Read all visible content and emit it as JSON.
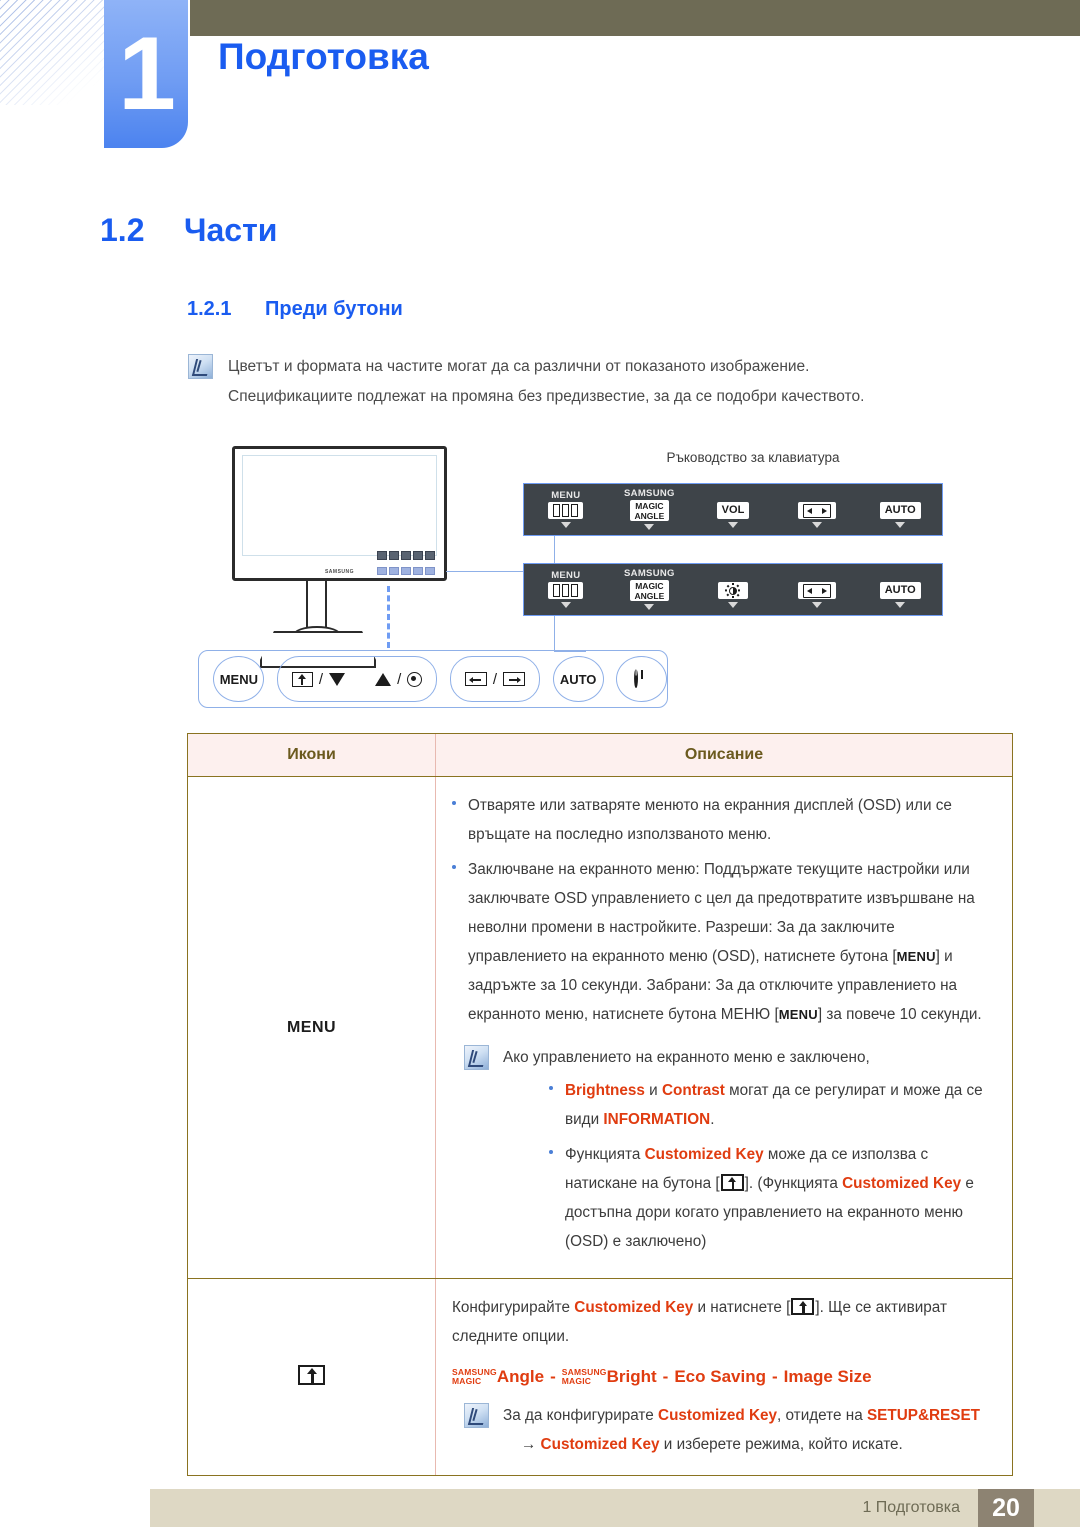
{
  "chapter": {
    "number": "1",
    "title": "Подготовка"
  },
  "headings": {
    "h1_num": "1.2",
    "h1_text": "Части",
    "h2_num": "1.2.1",
    "h2_text": "Преди бутони"
  },
  "top_note": {
    "icon": "note-icon",
    "line1": "Цветът и формата на частите могат да са различни от показаното изображение.",
    "line2": "Спецификациите подлежат на промяна без предизвестие, за да се подобри качеството."
  },
  "figure": {
    "monitor_logo": "SAMSUNG",
    "keyboard_guide_title": "Ръководство за клавиатура",
    "panels": [
      {
        "keys": [
          {
            "cap": "MENU",
            "glyph": "menu-bars-icon",
            "label": ""
          },
          {
            "cap": "SAMSUNG",
            "glyph": "magic-angle-box",
            "label": "MAGIC / ANGLE"
          },
          {
            "cap": "",
            "glyph": "text-box",
            "label": "VOL"
          },
          {
            "cap": "",
            "glyph": "source-icon",
            "label": ""
          },
          {
            "cap": "",
            "glyph": "text-box",
            "label": "AUTO"
          }
        ]
      },
      {
        "keys": [
          {
            "cap": "MENU",
            "glyph": "menu-bars-icon",
            "label": ""
          },
          {
            "cap": "SAMSUNG",
            "glyph": "magic-angle-box",
            "label": "MAGIC / ANGLE"
          },
          {
            "cap": "",
            "glyph": "brightness-icon",
            "label": ""
          },
          {
            "cap": "",
            "glyph": "source-icon",
            "label": ""
          },
          {
            "cap": "",
            "glyph": "text-box",
            "label": "AUTO"
          }
        ]
      }
    ],
    "magic_top": "MAGIC",
    "magic_bottom": "ANGLE",
    "vol_label": "VOL",
    "auto_label": "AUTO",
    "samsung_label": "SAMSUNG",
    "menu_label": "MENU",
    "control_bar": {
      "menu": "MENU",
      "slash": "/",
      "auto": "AUTO"
    }
  },
  "table": {
    "headers": {
      "icons": "Икони",
      "description": "Описание"
    },
    "rows": [
      {
        "icon_label": "MENU",
        "icon_name": "menu-text-icon",
        "bullets": [
          "Отваряте или затваряте менюто на екранния дисплей (OSD) или се връщате на последно използваното меню.",
          "Заключване на екранното меню: Поддържате текущите настройки или заключвате OSD управлението с цел да предотвратите извършване на неволни промени в настройките. Разреши: За да заключите управлението на екранното меню (OSD), натиснете бутона"
        ],
        "lock_part2": "и задръжте за 10 секунди. Забрани: За да отключите управлението на екранното меню, натиснете бутона МЕНЮ",
        "lock_part3": "за повече 10 секунди.",
        "menu_kbd": "MENU",
        "note": {
          "intro": "Ако управлението на екранното меню е заключено,",
          "b1_a": "Brightness",
          "b1_and": "и",
          "b1_b": "Contrast",
          "b1_c": "могат да се регулират и може да се види",
          "b1_d": "INFORMATION",
          "b1_end": ".",
          "b2_a": "Функцията",
          "b2_b": "Customized Key",
          "b2_c": "може да се използва с натискане на бутона [",
          "b2_d": "]. (Функцията",
          "b2_e": "Customized Key",
          "b2_f": "е достъпна дори когато управлението на екранното меню (OSD) е заключено)"
        }
      },
      {
        "icon_label": "",
        "icon_name": "customized-key-icon",
        "line1_a": "Конфигурирайте",
        "line1_b": "Customized Key",
        "line1_c": "и натиснете [",
        "line1_d": "]. Ще се активират следните опции.",
        "options": {
          "magic1_top": "SAMSUNG",
          "magic1_bottom": "MAGIC",
          "opt1": "Angle",
          "magic2_top": "SAMSUNG",
          "magic2_bottom": "MAGIC",
          "opt2": "Bright",
          "opt3": "Eco Saving",
          "opt4": "Image Size",
          "separator": "-"
        },
        "note": {
          "a": "За да конфигурирате",
          "b": "Customized Key",
          "c": ", отидете на",
          "d": "SETUP&RESET",
          "arrow": "→",
          "e": "Customized Key",
          "f": "и изберете режима, който искате."
        }
      }
    ]
  },
  "footer": {
    "text": "1 Подготовка",
    "page": "20"
  },
  "colors": {
    "accent_blue": "#1a5cf0",
    "keyword_red": "#e03c10",
    "table_border": "#8a7320",
    "header_bg": "#fdf0ee",
    "olive": "#6e6b55",
    "footer_bg": "#ded8c4"
  }
}
